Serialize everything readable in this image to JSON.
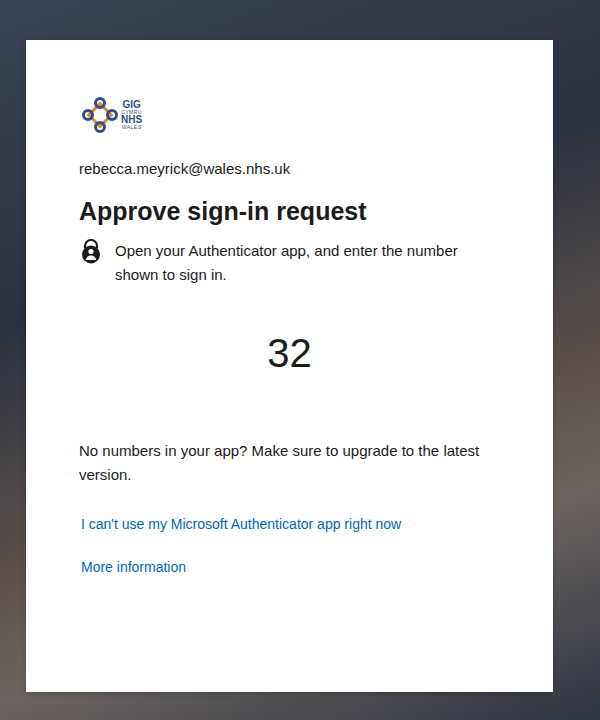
{
  "logo": {
    "lines": [
      {
        "text": "GIG",
        "kind": "big"
      },
      {
        "text": "CYMRU",
        "kind": "small"
      },
      {
        "text": "NHS",
        "kind": "big"
      },
      {
        "text": "WALES",
        "kind": "small"
      }
    ]
  },
  "account": {
    "email": "rebecca.meyrick@wales.nhs.uk"
  },
  "title": "Approve sign-in request",
  "instruction": "Open your Authenticator app, and enter the number shown to sign in.",
  "number": "32",
  "hint": "No numbers in your app? Make sure to upgrade to the latest version.",
  "links": [
    "I can't use my Microsoft Authenticator app right now",
    "More information"
  ]
}
